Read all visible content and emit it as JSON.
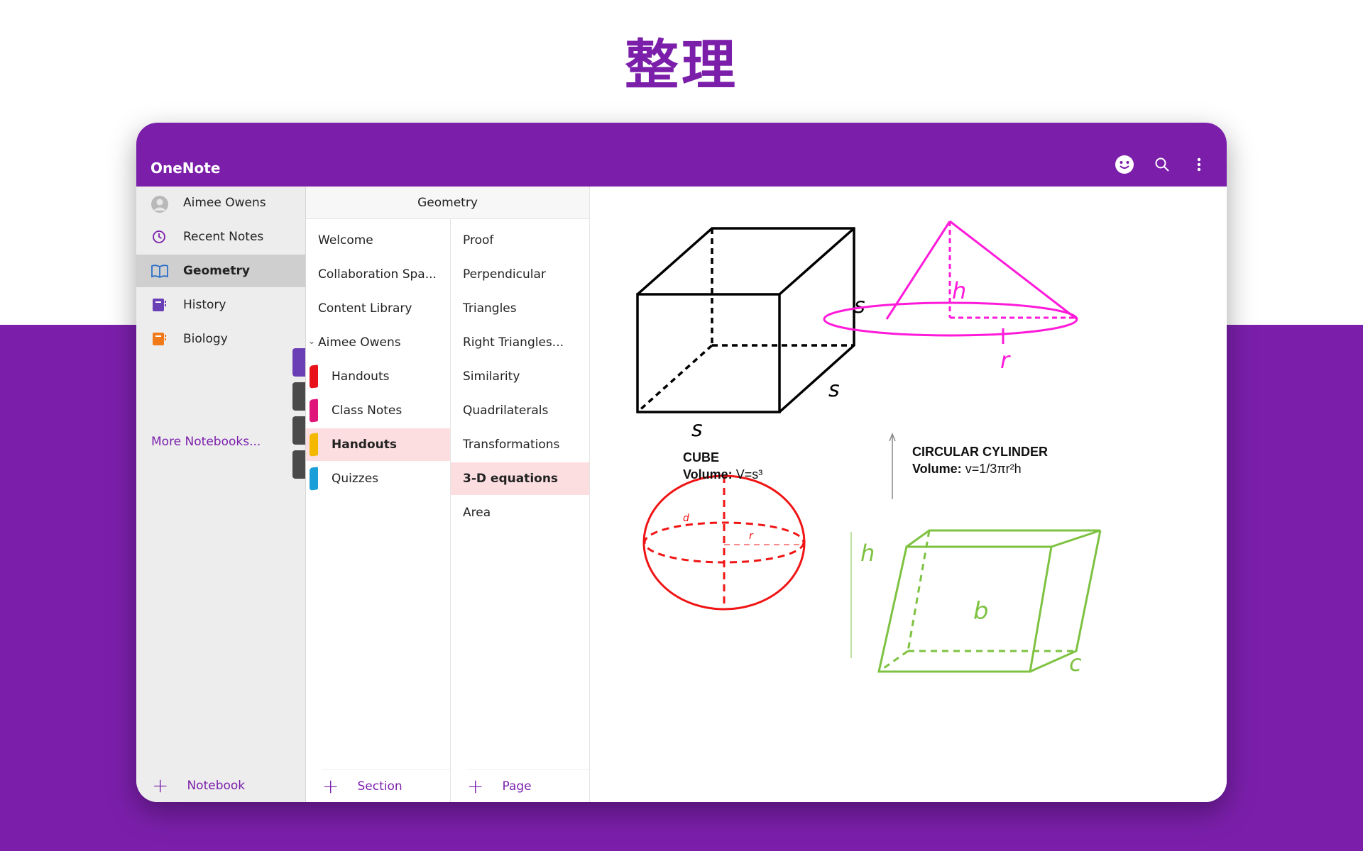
{
  "headline": "整理",
  "app": {
    "title": "OneNote"
  },
  "notebooks": {
    "user": "Aimee Owens",
    "items": [
      {
        "label": "Recent Notes"
      },
      {
        "label": "Geometry"
      },
      {
        "label": "History"
      },
      {
        "label": "Biology"
      }
    ],
    "more": "More Notebooks...",
    "add_label": "Notebook"
  },
  "sections": {
    "header": "Geometry",
    "items": [
      {
        "label": "Welcome"
      },
      {
        "label": "Collaboration Spa..."
      },
      {
        "label": "Content Library"
      },
      {
        "label": "Aimee Owens"
      },
      {
        "label": "Handouts"
      },
      {
        "label": "Class Notes"
      },
      {
        "label": "Handouts"
      },
      {
        "label": "Quizzes"
      }
    ],
    "add_label": "Section"
  },
  "pages": {
    "items": [
      {
        "label": "Proof"
      },
      {
        "label": "Perpendicular"
      },
      {
        "label": "Triangles"
      },
      {
        "label": "Right Triangles..."
      },
      {
        "label": "Similarity"
      },
      {
        "label": "Quadrilaterals"
      },
      {
        "label": "Transformations"
      },
      {
        "label": "3-D equations"
      },
      {
        "label": "Area"
      }
    ],
    "add_label": "Page"
  },
  "canvas": {
    "cube_title": "CUBE",
    "cube_volume_label": "Volume:",
    "cube_formula": "V=s³",
    "cylinder_title": "CIRCULAR CYLINDER",
    "cylinder_volume_label": "Volume:",
    "cylinder_formula": "v=1/3πr²h",
    "cube_side_labels": [
      "s",
      "s",
      "s"
    ],
    "cone_labels": {
      "height": "h",
      "radius": "r"
    },
    "sphere_labels": {
      "diameter": "d",
      "radius": "r"
    },
    "prism_labels": {
      "height": "h",
      "base": "b",
      "depth": "c"
    }
  },
  "colors": {
    "brand": "#7b1fab",
    "selected_row": "#fcdde0",
    "cone": "#ff1ad9",
    "sphere": "#f01414",
    "prism": "#7ec242",
    "section_handouts_1": "#e8121a",
    "section_class_notes": "#e0157a",
    "section_handouts_2": "#f5b800",
    "section_quizzes": "#1a9fd9"
  }
}
